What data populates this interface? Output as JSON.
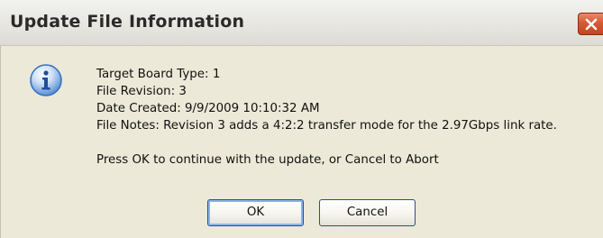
{
  "dialog": {
    "title": "Update File Information",
    "icon": "info-icon",
    "lines": {
      "board_type": "Target Board Type: 1",
      "file_revision": "File Revision: 3",
      "date_created": "Date Created: 9/9/2009 10:10:32 AM",
      "file_notes": "File Notes: Revision 3 adds a 4:2:2 transfer mode for the 2.97Gbps link rate.",
      "prompt": "Press OK to continue with the update, or Cancel to Abort"
    },
    "buttons": {
      "ok": "OK",
      "cancel": "Cancel"
    },
    "colors": {
      "close_button": "#d55a35",
      "info_icon_blue": "#2f6fc4",
      "button_border": "#2c4f8a"
    }
  }
}
